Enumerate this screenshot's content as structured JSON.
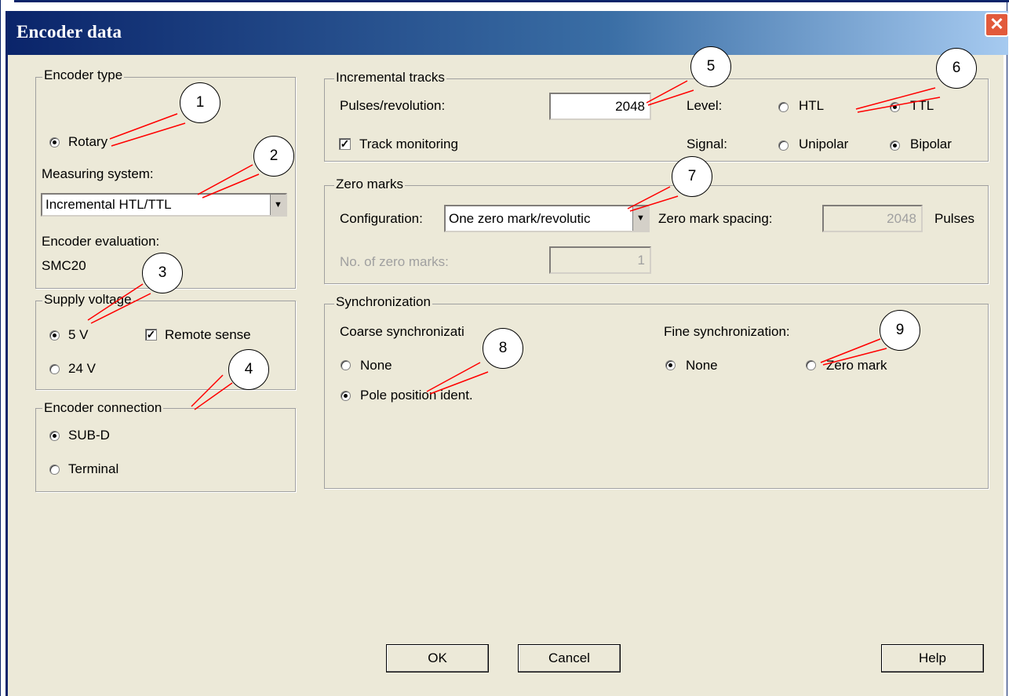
{
  "window": {
    "title": "Encoder data",
    "close_label": "✕"
  },
  "encoder_type": {
    "legend": "Encoder type",
    "rotary_label": "Rotary",
    "measuring_system_label": "Measuring system:",
    "measuring_system_value": "Incremental HTL/TTL",
    "evaluation_label": "Encoder evaluation:",
    "evaluation_value": "SMC20"
  },
  "supply_voltage": {
    "legend": "Supply voltage",
    "v5_label": "5 V",
    "v24_label": "24 V",
    "remote_sense_label": "Remote sense"
  },
  "encoder_connection": {
    "legend": "Encoder connection",
    "subd_label": "SUB-D",
    "terminal_label": "Terminal"
  },
  "incremental_tracks": {
    "legend": "Incremental tracks",
    "pulses_label": "Pulses/revolution:",
    "pulses_value": "2048",
    "level_label": "Level:",
    "htl_label": "HTL",
    "ttl_label": "TTL",
    "track_monitoring_label": "Track monitoring",
    "signal_label": "Signal:",
    "unipolar_label": "Unipolar",
    "bipolar_label": "Bipolar"
  },
  "zero_marks": {
    "legend": "Zero marks",
    "configuration_label": "Configuration:",
    "configuration_value": "One zero mark/revolutic",
    "spacing_label": "Zero mark spacing:",
    "spacing_value": "2048",
    "spacing_unit": "Pulses",
    "count_label": "No. of zero marks:",
    "count_value": "1"
  },
  "synchronization": {
    "legend": "Synchronization",
    "coarse_label": "Coarse synchronizati",
    "coarse_none_label": "None",
    "pole_position_label": "Pole position ident.",
    "fine_label": "Fine synchronization:",
    "fine_none_label": "None",
    "zero_mark_label": "Zero mark"
  },
  "buttons": {
    "ok": "OK",
    "cancel": "Cancel",
    "help": "Help"
  },
  "callouts": [
    "1",
    "2",
    "3",
    "4",
    "5",
    "6",
    "7",
    "8",
    "9"
  ],
  "icons": {
    "close": "close-icon",
    "dropdown": "chevron-down-icon",
    "check": "check-icon"
  },
  "colors": {
    "title_bar": "#0a246a",
    "dialog_face": "#ece9d8",
    "close_button": "#e25a3b",
    "callout_line": "#ff0000"
  }
}
